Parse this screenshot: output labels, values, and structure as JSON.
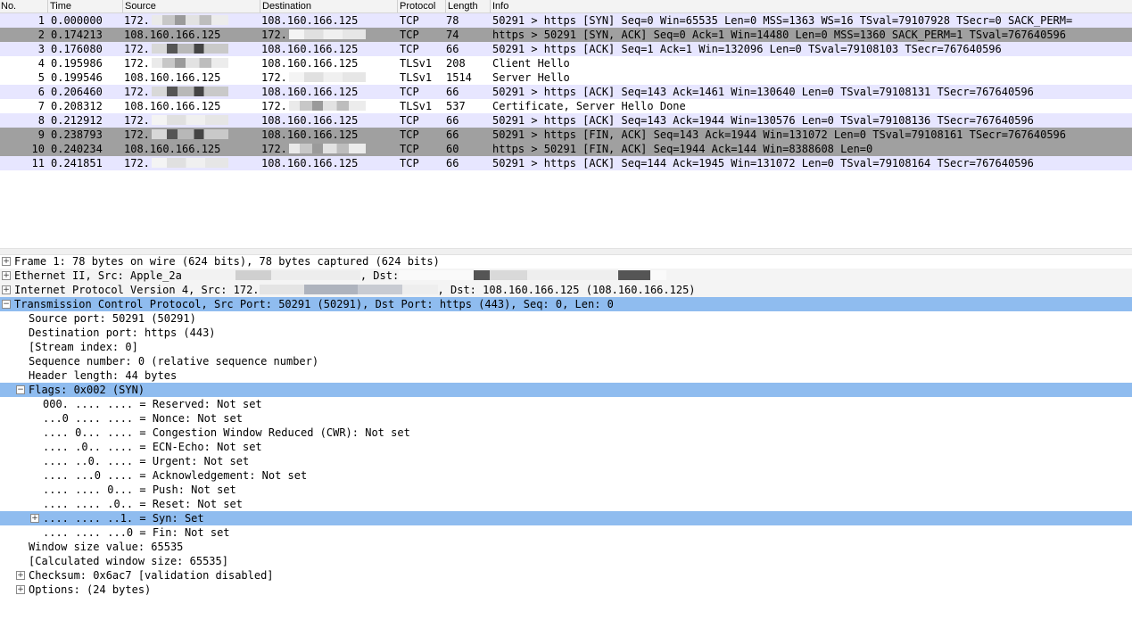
{
  "packet_list": {
    "columns": [
      "No.",
      "Time",
      "Source",
      "Destination",
      "Protocol",
      "Length",
      "Info"
    ],
    "rows": [
      {
        "no": "1",
        "time": "0.000000",
        "source": "172.",
        "destination": "108.160.166.125",
        "protocol": "TCP",
        "length": "78",
        "info": "50291 > https [SYN] Seq=0 Win=65535 Len=0 MSS=1363 WS=16 TSval=79107928 TSecr=0 SACK_PERM=",
        "style": "lav"
      },
      {
        "no": "2",
        "time": "0.174213",
        "source": "108.160.166.125",
        "destination": "172.",
        "protocol": "TCP",
        "length": "74",
        "info": "https > 50291 [SYN, ACK] Seq=0 Ack=1 Win=14480 Len=0 MSS=1360 SACK_PERM=1 TSval=767640596",
        "style": "dark"
      },
      {
        "no": "3",
        "time": "0.176080",
        "source": "172.",
        "destination": "108.160.166.125",
        "protocol": "TCP",
        "length": "66",
        "info": "50291 > https [ACK] Seq=1 Ack=1 Win=132096 Len=0 TSval=79108103 TSecr=767640596",
        "style": "lav"
      },
      {
        "no": "4",
        "time": "0.195986",
        "source": "172.",
        "destination": "108.160.166.125",
        "protocol": "TLSv1",
        "length": "208",
        "info": "Client Hello",
        "style": "white"
      },
      {
        "no": "5",
        "time": "0.199546",
        "source": "108.160.166.125",
        "destination": "172.",
        "protocol": "TLSv1",
        "length": "1514",
        "info": "Server Hello",
        "style": "white"
      },
      {
        "no": "6",
        "time": "0.206460",
        "source": "172.",
        "destination": "108.160.166.125",
        "protocol": "TCP",
        "length": "66",
        "info": "50291 > https [ACK] Seq=143 Ack=1461 Win=130640 Len=0 TSval=79108131 TSecr=767640596",
        "style": "lav"
      },
      {
        "no": "7",
        "time": "0.208312",
        "source": "108.160.166.125",
        "destination": "172.",
        "protocol": "TLSv1",
        "length": "537",
        "info": "Certificate, Server Hello Done",
        "style": "white"
      },
      {
        "no": "8",
        "time": "0.212912",
        "source": "172.",
        "destination": "108.160.166.125",
        "protocol": "TCP",
        "length": "66",
        "info": "50291 > https [ACK] Seq=143 Ack=1944 Win=130576 Len=0 TSval=79108136 TSecr=767640596",
        "style": "lav"
      },
      {
        "no": "9",
        "time": "0.238793",
        "source": "172.",
        "destination": "108.160.166.125",
        "protocol": "TCP",
        "length": "66",
        "info": "50291 > https [FIN, ACK] Seq=143 Ack=1944 Win=131072 Len=0 TSval=79108161 TSecr=767640596",
        "style": "dark"
      },
      {
        "no": "10",
        "time": "0.240234",
        "source": "108.160.166.125",
        "destination": "172.",
        "protocol": "TCP",
        "length": "60",
        "info": "https > 50291 [FIN, ACK] Seq=1944 Ack=144 Win=8388608 Len=0",
        "style": "dark"
      },
      {
        "no": "11",
        "time": "0.241851",
        "source": "172.",
        "destination": "108.160.166.125",
        "protocol": "TCP",
        "length": "66",
        "info": "50291 > https [ACK] Seq=144 Ack=1945 Win=131072 Len=0 TSval=79108164 TSecr=767640596",
        "style": "lav"
      }
    ]
  },
  "details": [
    {
      "text": "Frame 1: 78 bytes on wire (624 bits), 78 bytes captured (624 bits)",
      "level": 0,
      "toggle": "plus",
      "style": "white"
    },
    {
      "text": "Ethernet II, Src: Apple_2a",
      "after_redact": ", Dst:",
      "level": 0,
      "toggle": "plus",
      "style": "lite"
    },
    {
      "text": "Internet Protocol Version 4, Src: 172.",
      "after_redact": ", Dst: 108.160.166.125 (108.160.166.125)",
      "level": 0,
      "toggle": "plus",
      "style": "lite"
    },
    {
      "text": "Transmission Control Protocol, Src Port: 50291 (50291), Dst Port: https (443), Seq: 0, Len: 0",
      "level": 0,
      "toggle": "minus",
      "style": "sel"
    },
    {
      "text": "Source port: 50291 (50291)",
      "level": 1,
      "toggle": "",
      "style": "white"
    },
    {
      "text": "Destination port: https (443)",
      "level": 1,
      "toggle": "",
      "style": "white"
    },
    {
      "text": "[Stream index: 0]",
      "level": 1,
      "toggle": "",
      "style": "white"
    },
    {
      "text": "Sequence number: 0    (relative sequence number)",
      "level": 1,
      "toggle": "",
      "style": "white"
    },
    {
      "text": "Header length: 44 bytes",
      "level": 1,
      "toggle": "",
      "style": "white"
    },
    {
      "text": "Flags: 0x002 (SYN)",
      "level": 1,
      "toggle": "minus",
      "style": "sel"
    },
    {
      "text": "000. .... .... = Reserved: Not set",
      "level": 2,
      "toggle": "",
      "style": "white"
    },
    {
      "text": "...0 .... .... = Nonce: Not set",
      "level": 2,
      "toggle": "",
      "style": "white"
    },
    {
      "text": ".... 0... .... = Congestion Window Reduced (CWR): Not set",
      "level": 2,
      "toggle": "",
      "style": "white"
    },
    {
      "text": ".... .0.. .... = ECN-Echo: Not set",
      "level": 2,
      "toggle": "",
      "style": "white"
    },
    {
      "text": ".... ..0. .... = Urgent: Not set",
      "level": 2,
      "toggle": "",
      "style": "white"
    },
    {
      "text": ".... ...0 .... = Acknowledgement: Not set",
      "level": 2,
      "toggle": "",
      "style": "white"
    },
    {
      "text": ".... .... 0... = Push: Not set",
      "level": 2,
      "toggle": "",
      "style": "white"
    },
    {
      "text": ".... .... .0.. = Reset: Not set",
      "level": 2,
      "toggle": "",
      "style": "white"
    },
    {
      "text": ".... .... ..1. = Syn: Set",
      "level": 2,
      "toggle": "plus",
      "style": "sel"
    },
    {
      "text": ".... .... ...0 = Fin: Not set",
      "level": 2,
      "toggle": "",
      "style": "white"
    },
    {
      "text": "Window size value: 65535",
      "level": 1,
      "toggle": "",
      "style": "white"
    },
    {
      "text": "[Calculated window size: 65535]",
      "level": 1,
      "toggle": "",
      "style": "white"
    },
    {
      "text": "Checksum: 0x6ac7 [validation disabled]",
      "level": 1,
      "toggle": "plus",
      "style": "white"
    },
    {
      "text": "Options: (24 bytes)",
      "level": 1,
      "toggle": "plus",
      "style": "white"
    }
  ],
  "icons": {
    "expand": "plus-box-icon",
    "collapse": "minus-box-icon",
    "plus_glyph": "+",
    "minus_glyph": "−"
  },
  "colors": {
    "row_lavender": "#e7e6ff",
    "row_dark": "#a0a0a0",
    "selection": "#8fbcef"
  }
}
